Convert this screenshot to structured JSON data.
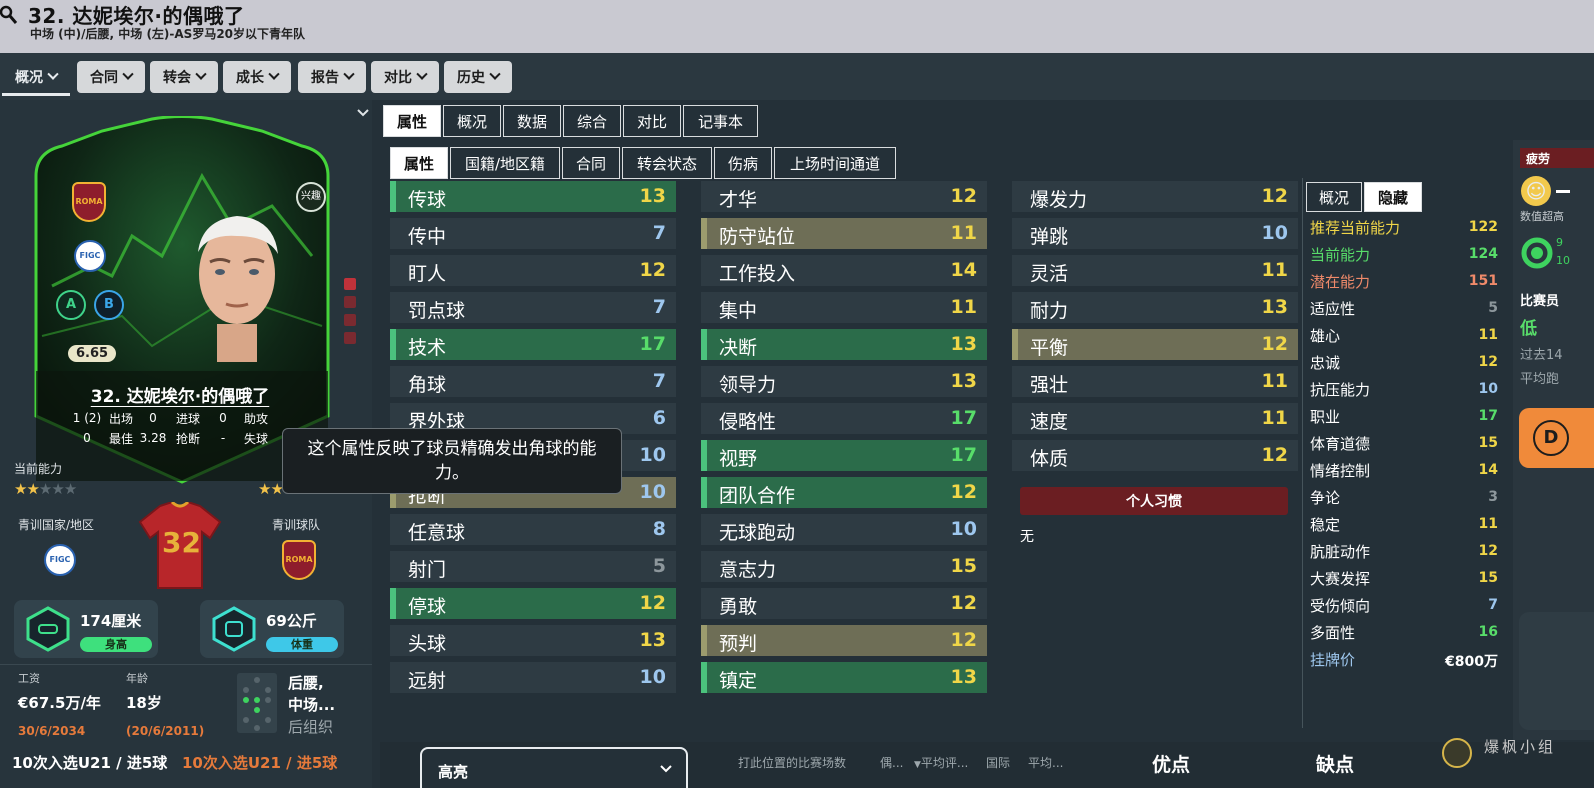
{
  "header": {
    "title": "32. 达妮埃尔·的偶哦了",
    "subtitle": "中场 (中)/后腰, 中场 (左)-AS罗马20岁以下青年队"
  },
  "toolbar": {
    "tabs": [
      "概况",
      "合同",
      "转会",
      "成长",
      "报告",
      "对比",
      "历史"
    ]
  },
  "card": {
    "rating": "6.65",
    "badge_label": "兴趣",
    "club_logo_text": "ROMA",
    "federation_text": "FIGC",
    "foot_left": "A",
    "foot_right": "B",
    "name": "32. 达妮埃尔·的偶哦了",
    "stats": {
      "apps": "1 (2)",
      "apps_label": "出场",
      "goals": "0",
      "goals_label": "进球",
      "assists": "0",
      "assists_label": "助攻",
      "motm": "0",
      "motm_label": "最佳",
      "tackles": "3.28",
      "tackles_label": "抢断",
      "lost": "-",
      "lost_label": "失球"
    }
  },
  "left": {
    "current_ability_label": "当前能力",
    "current_stars": 1.5,
    "potential_stars": 2,
    "youth_nation_label": "青训国家/地区",
    "youth_club_label": "青训球队",
    "shirt_number": "32",
    "height_value": "174厘米",
    "height_label": "身高",
    "weight_value": "69公斤",
    "weight_label": "体重",
    "wage_label": "工资",
    "wage_value": "€67.5万/年",
    "wage_expiry": "30/6/2034",
    "age_label": "年龄",
    "age_value": "18岁",
    "dob": "(20/6/2011)",
    "position_line1": "后腰,",
    "position_line2": "中场...",
    "position_role": "后组织",
    "caps_white": "10次入选U21 / 进5球",
    "caps_orange": "10次入选U21 / 进5球"
  },
  "center": {
    "main_tabs": [
      "属性",
      "概况",
      "数据",
      "综合",
      "对比",
      "记事本"
    ],
    "sub_tabs": [
      "属性",
      "国籍/地区籍",
      "合同",
      "转会状态",
      "伤病",
      "上场时间通道"
    ],
    "col1": [
      {
        "name": "传球",
        "value": "13",
        "hl": "green",
        "c": "yel"
      },
      {
        "name": "传中",
        "value": "7",
        "hl": "",
        "c": "blu"
      },
      {
        "name": "盯人",
        "value": "12",
        "hl": "",
        "c": "yel"
      },
      {
        "name": "罚点球",
        "value": "7",
        "hl": "",
        "c": "blu"
      },
      {
        "name": "技术",
        "value": "17",
        "hl": "green",
        "c": "grn"
      },
      {
        "name": "角球",
        "value": "7",
        "hl": "",
        "c": "blu"
      },
      {
        "name": "界外球",
        "value": "6",
        "hl": "",
        "c": "blu"
      },
      {
        "name": "",
        "value": "10",
        "hl": "",
        "c": "blu"
      },
      {
        "name": "抢断",
        "value": "10",
        "hl": "olive",
        "c": "blu"
      },
      {
        "name": "任意球",
        "value": "8",
        "hl": "",
        "c": "blu"
      },
      {
        "name": "射门",
        "value": "5",
        "hl": "",
        "c": "gry"
      },
      {
        "name": "停球",
        "value": "12",
        "hl": "green",
        "c": "yel"
      },
      {
        "name": "头球",
        "value": "13",
        "hl": "",
        "c": "yel"
      },
      {
        "name": "远射",
        "value": "10",
        "hl": "",
        "c": "blu"
      }
    ],
    "col2": [
      {
        "name": "才华",
        "value": "12",
        "hl": "",
        "c": "yel"
      },
      {
        "name": "防守站位",
        "value": "11",
        "hl": "olive",
        "c": "yel"
      },
      {
        "name": "工作投入",
        "value": "14",
        "hl": "",
        "c": "yel"
      },
      {
        "name": "集中",
        "value": "11",
        "hl": "",
        "c": "yel"
      },
      {
        "name": "决断",
        "value": "13",
        "hl": "green",
        "c": "yel"
      },
      {
        "name": "领导力",
        "value": "13",
        "hl": "",
        "c": "yel"
      },
      {
        "name": "侵略性",
        "value": "17",
        "hl": "",
        "c": "grn"
      },
      {
        "name": "视野",
        "value": "17",
        "hl": "green",
        "c": "grn"
      },
      {
        "name": "团队合作",
        "value": "12",
        "hl": "green",
        "c": "yel"
      },
      {
        "name": "无球跑动",
        "value": "10",
        "hl": "",
        "c": "blu"
      },
      {
        "name": "意志力",
        "value": "15",
        "hl": "",
        "c": "yel"
      },
      {
        "name": "勇敢",
        "value": "12",
        "hl": "",
        "c": "yel"
      },
      {
        "name": "预判",
        "value": "12",
        "hl": "olive",
        "c": "yel"
      },
      {
        "name": "镇定",
        "value": "13",
        "hl": "green",
        "c": "yel"
      }
    ],
    "col3": [
      {
        "name": "爆发力",
        "value": "12",
        "hl": "",
        "c": "yel"
      },
      {
        "name": "弹跳",
        "value": "10",
        "hl": "",
        "c": "blu"
      },
      {
        "name": "灵活",
        "value": "11",
        "hl": "",
        "c": "yel"
      },
      {
        "name": "耐力",
        "value": "13",
        "hl": "",
        "c": "yel"
      },
      {
        "name": "平衡",
        "value": "12",
        "hl": "olive",
        "c": "yel"
      },
      {
        "name": "强壮",
        "value": "11",
        "hl": "",
        "c": "yel"
      },
      {
        "name": "速度",
        "value": "11",
        "hl": "",
        "c": "yel"
      },
      {
        "name": "体质",
        "value": "12",
        "hl": "",
        "c": "yel"
      }
    ],
    "tooltip": "这个属性反映了球员精确发出角球的能力。",
    "habits_label": "个人习惯",
    "habits_value": "无"
  },
  "hidden_panel": {
    "tabs": [
      "概况",
      "隐藏"
    ],
    "rows": [
      {
        "name": "推荐当前能力",
        "value": "122",
        "nc": "#f0d648",
        "vc": "#f0d648"
      },
      {
        "name": "当前能力",
        "value": "124",
        "nc": "#58dd6a",
        "vc": "#58dd6a"
      },
      {
        "name": "潜在能力",
        "value": "151",
        "nc": "#f08a6a",
        "vc": "#f08a6a"
      },
      {
        "name": "适应性",
        "value": "5",
        "nc": "#ffffff",
        "vc": "#8d979c"
      },
      {
        "name": "雄心",
        "value": "11",
        "nc": "#ffffff",
        "vc": "#f0d648"
      },
      {
        "name": "忠诚",
        "value": "12",
        "nc": "#ffffff",
        "vc": "#f0d648"
      },
      {
        "name": "抗压能力",
        "value": "10",
        "nc": "#ffffff",
        "vc": "#9ec7ee"
      },
      {
        "name": "职业",
        "value": "17",
        "nc": "#ffffff",
        "vc": "#58dd6a"
      },
      {
        "name": "体育道德",
        "value": "15",
        "nc": "#ffffff",
        "vc": "#f0d648"
      },
      {
        "name": "情绪控制",
        "value": "14",
        "nc": "#ffffff",
        "vc": "#f0d648"
      },
      {
        "name": "争论",
        "value": "3",
        "nc": "#ffffff",
        "vc": "#8d979c"
      },
      {
        "name": "稳定",
        "value": "11",
        "nc": "#ffffff",
        "vc": "#f0d648"
      },
      {
        "name": "肮脏动作",
        "value": "12",
        "nc": "#ffffff",
        "vc": "#f0d648"
      },
      {
        "name": "大赛发挥",
        "value": "15",
        "nc": "#ffffff",
        "vc": "#f0d648"
      },
      {
        "name": "受伤倾向",
        "value": "7",
        "nc": "#ffffff",
        "vc": "#9ec7ee"
      },
      {
        "name": "多面性",
        "value": "16",
        "nc": "#ffffff",
        "vc": "#58dd6a"
      },
      {
        "name": "挂牌价",
        "value": "€800万",
        "nc": "#9ec7ee",
        "vc": "#ffffff"
      }
    ]
  },
  "right_edge": {
    "fatigue_label": "疲劳",
    "value_text": "数值超高",
    "ring_top": "9",
    "ring_bottom": "10",
    "match_label": "比赛员",
    "match_value": "低",
    "past_label": "过去14",
    "avg_label": "平均跑",
    "grade_letter": "D"
  },
  "bottom": {
    "select_value": "高亮",
    "col_headers": [
      "打此位置的比赛场数",
      "偶...",
      "平均评...",
      "国际",
      "平均..."
    ],
    "strengths": "优点",
    "weaknesses": "缺点",
    "watermark": "爆枫小组"
  }
}
